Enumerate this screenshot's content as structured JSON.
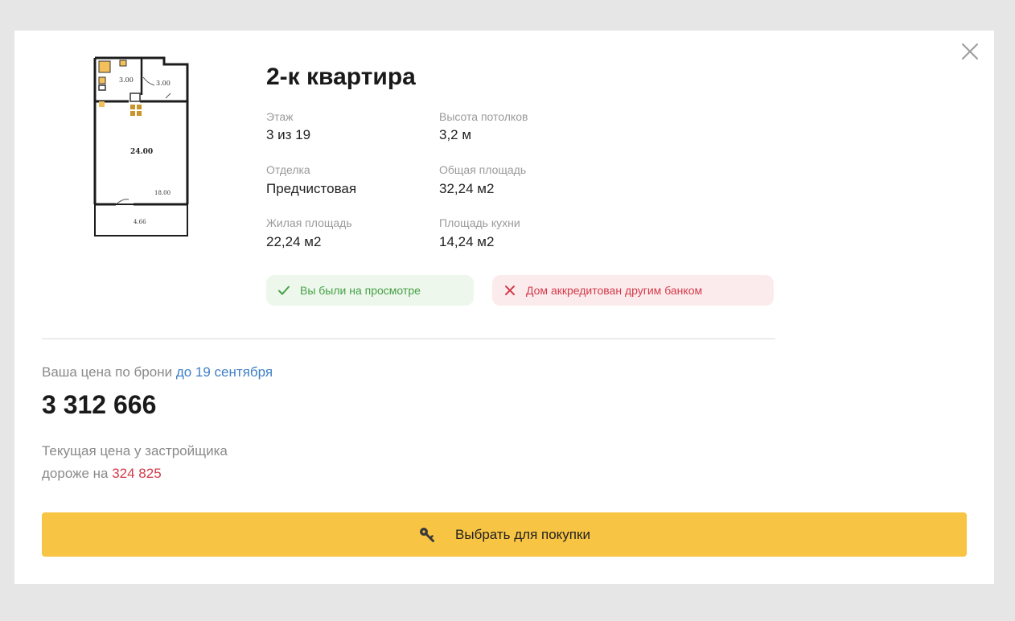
{
  "apartment": {
    "title": "2-к квартира"
  },
  "properties": [
    {
      "label": "Этаж",
      "value": "3 из 19"
    },
    {
      "label": "Высота потолков",
      "value": "3,2 м"
    },
    {
      "label": "Отделка",
      "value": "Предчистовая"
    },
    {
      "label": "Общая площадь",
      "value": "32,24 м2"
    },
    {
      "label": "Жилая площадь",
      "value": "22,24 м2"
    },
    {
      "label": "Площадь кухни",
      "value": "14,24 м2"
    }
  ],
  "floorplan": {
    "labels": [
      "3.00",
      "3.00",
      "24.00",
      "18.00",
      "4.66"
    ]
  },
  "badges": {
    "visited": "Вы были на просмотре",
    "bank": "Дом аккредитован другим банком"
  },
  "pricing": {
    "caption": "Ваша цена по брони ",
    "deadline_link": "до 19 сентября",
    "price": "3 312 666",
    "note_line1": "Текущая цена у застройщика",
    "note_line2_prefix": "дороже на ",
    "difference": "324 825"
  },
  "actions": {
    "buy_label": "Выбрать для покупки"
  },
  "icons": {
    "close": "close-icon",
    "check": "check-icon",
    "cross": "cross-icon",
    "key": "key-icon"
  },
  "colors": {
    "accent_button": "#f8c443",
    "link": "#3f7fc7",
    "success": "#46a046",
    "danger": "#d33a49"
  }
}
